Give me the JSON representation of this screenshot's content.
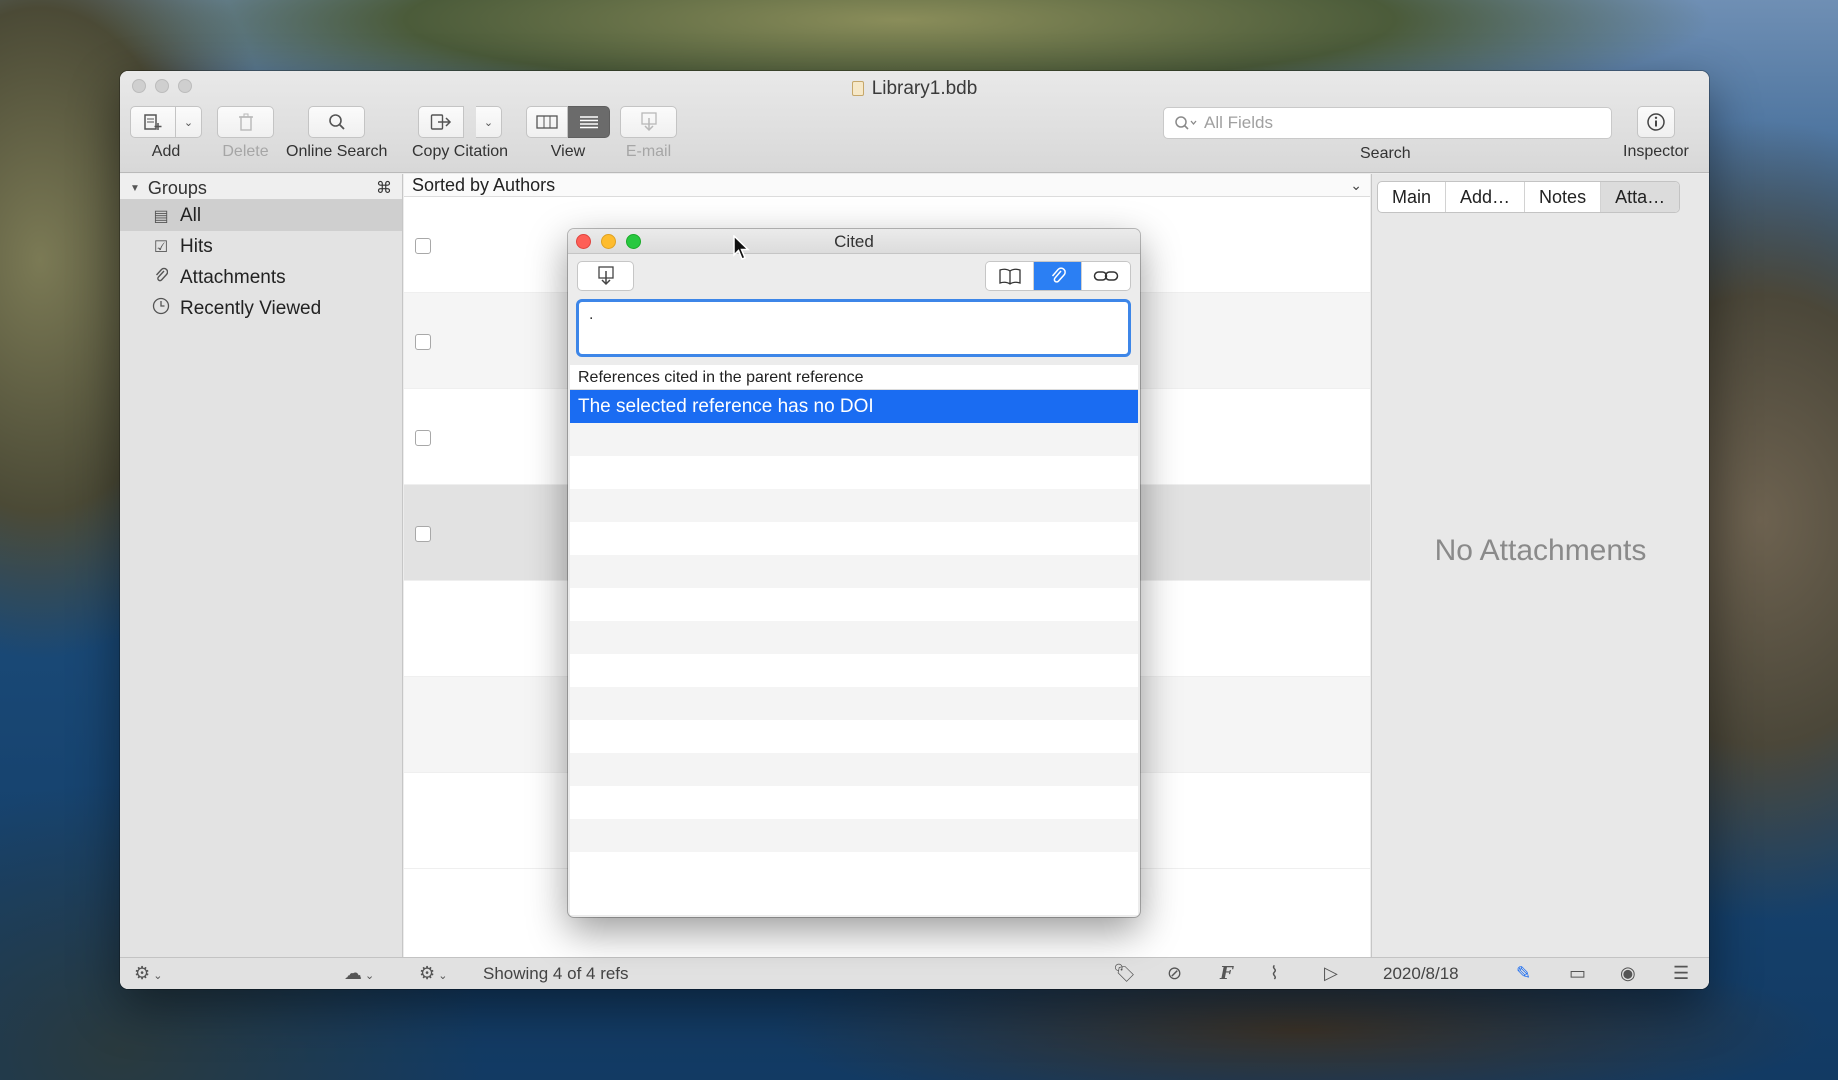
{
  "window": {
    "title": "Library1.bdb"
  },
  "toolbar": {
    "add_label": "Add",
    "delete_label": "Delete",
    "online_search_label": "Online Search",
    "copy_citation_label": "Copy Citation",
    "view_label": "View",
    "email_label": "E-mail",
    "search_placeholder": "All Fields",
    "search_label": "Search",
    "inspector_label": "Inspector"
  },
  "sidebar": {
    "groups_label": "Groups",
    "groups_shortcut": "⌘",
    "items": [
      {
        "label": "All",
        "icon": "library-icon",
        "selected": true
      },
      {
        "label": "Hits",
        "icon": "checkbox-icon",
        "selected": false
      },
      {
        "label": "Attachments",
        "icon": "paperclip-icon",
        "selected": false
      },
      {
        "label": "Recently Viewed",
        "icon": "clock-icon",
        "selected": false
      }
    ]
  },
  "list": {
    "sort_label": "Sorted by Authors",
    "row_count": 4
  },
  "inspector": {
    "tabs": [
      "Main",
      "Add…",
      "Notes",
      "Atta…"
    ],
    "active_tab": "Atta…",
    "empty_message": "No Attachments"
  },
  "status": {
    "text": "Showing 4 of 4 refs",
    "date": "2020/8/18"
  },
  "dialog": {
    "title": "Cited",
    "input_value": ".",
    "list_header": "References cited in the parent reference",
    "selected_row": "The selected reference has no DOI",
    "accent_color": "#1a6cf2"
  }
}
